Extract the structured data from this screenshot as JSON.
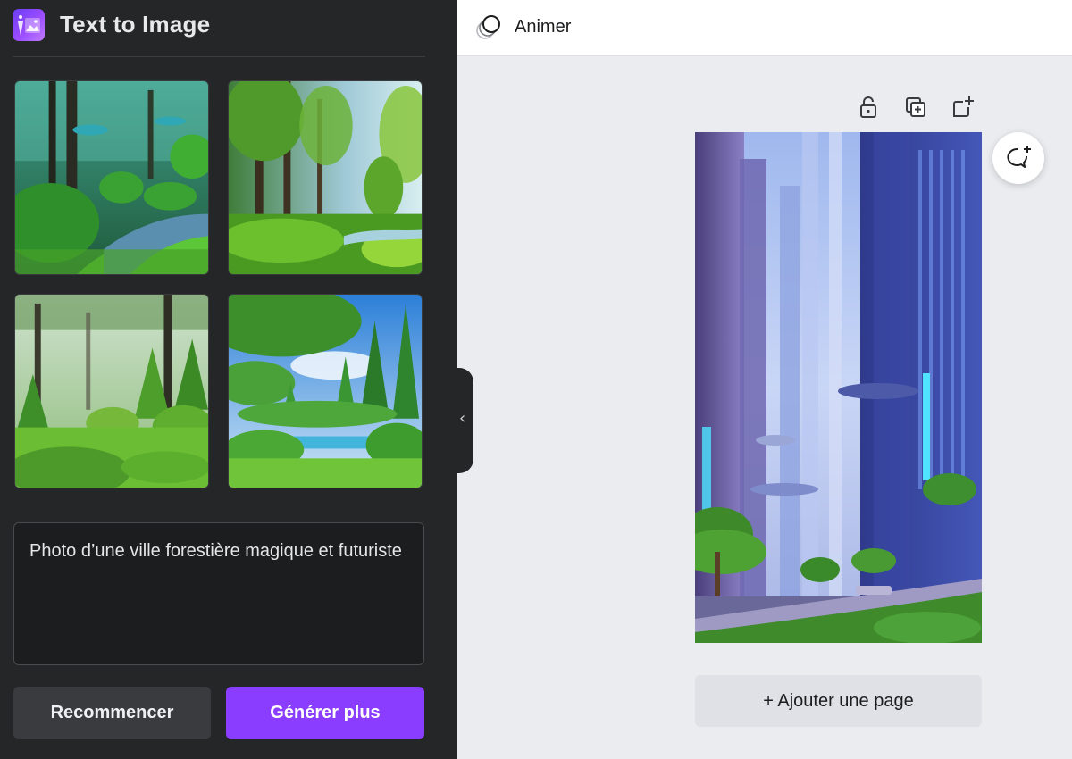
{
  "panel": {
    "title": "Text to Image",
    "prompt_value": "Photo d’une ville forestière magique et futuriste",
    "restart_label": "Recommencer",
    "generate_label": "Générer plus",
    "thumbnails": [
      {
        "icon": "forest-image-1"
      },
      {
        "icon": "forest-image-2"
      },
      {
        "icon": "forest-image-3"
      },
      {
        "icon": "forest-image-4"
      }
    ]
  },
  "topbar": {
    "animate_label": "Animer"
  },
  "canvas": {
    "page_tools": [
      "lock-icon",
      "duplicate-page-icon",
      "add-page-icon"
    ],
    "add_page_label": "+ Ajouter une page"
  },
  "colors": {
    "accent": "#8b3dff",
    "panel_bg": "#252627",
    "workspace_bg": "#ebecf0"
  }
}
